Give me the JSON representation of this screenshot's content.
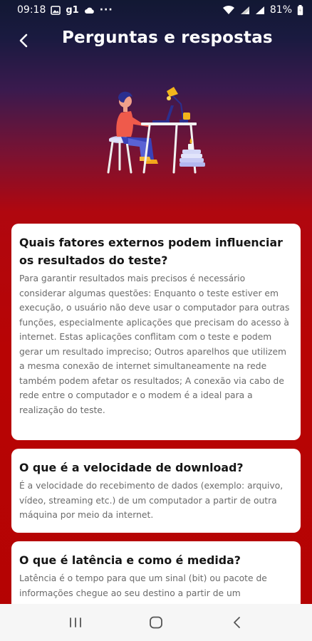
{
  "status_bar": {
    "time": "09:18",
    "carrier": "g1",
    "more": "···",
    "battery_percent": "81%",
    "icons": [
      "image-icon",
      "cloud-icon",
      "wifi-icon",
      "signal-icon",
      "signal-icon",
      "battery-icon"
    ]
  },
  "header": {
    "back_icon": "chevron-left-icon",
    "title": "Perguntas e respostas"
  },
  "illustration": {
    "icon": "person-at-desk-illustration"
  },
  "faq": [
    {
      "question": "Quais fatores externos podem influenciar os resultados do teste?",
      "answer": "Para garantir resultados mais precisos é necessário considerar algumas questões:  Enquanto o teste estiver em execução, o usuário não deve usar o computador para outras funções, especialmente aplicações que precisam do acesso à internet. Estas aplicações conflitam com o teste e podem gerar um resultado impreciso;  Outros aparelhos que utilizem a mesma conexão de internet simultaneamente na rede também podem afetar os resultados;  A conexão via cabo de rede entre o computador e o modem é a ideal para a realização do teste."
    },
    {
      "question": "O que é a velocidade de download?",
      "answer": "É a velocidade do recebimento de dados (exemplo: arquivo, vídeo, streaming etc.) de um computador a partir de outra máquina por meio da internet."
    },
    {
      "question": "O que é latência e como é medida?",
      "answer": "Latência é o tempo para que um sinal (bit) ou pacote de informações chegue ao seu destino a partir de um"
    }
  ],
  "nav_bar": {
    "recent_icon": "recent-apps-icon",
    "home_icon": "home-icon",
    "back_icon": "back-icon"
  },
  "colors": {
    "header_top": "#121833",
    "background_red": "#b80404",
    "card": "#ffffff",
    "nav_bar": "#f6f6f6"
  }
}
